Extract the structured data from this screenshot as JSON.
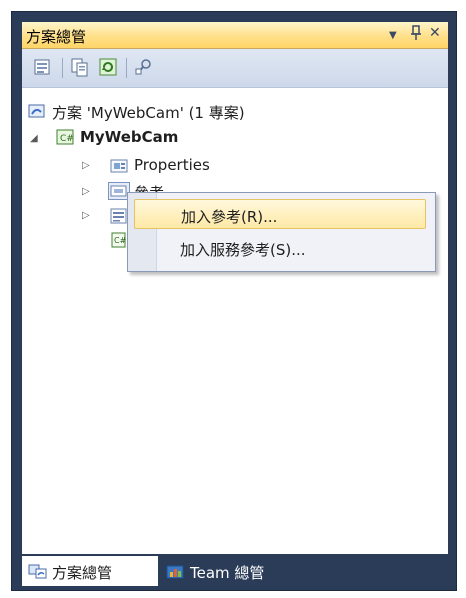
{
  "panel": {
    "title": "方案總管",
    "dropdown_glyph": "▼",
    "pin_glyph": "ᛉ",
    "close_glyph": "✕"
  },
  "toolbar": {
    "buttons": [
      "properties-icon",
      "show-all-files-icon",
      "refresh-icon",
      "class-diagram-icon"
    ]
  },
  "tree": {
    "solution": {
      "label": "方案 'MyWebCam' (1 專案)",
      "icon": "solution-icon"
    },
    "project": {
      "label": "MyWebCam",
      "icon": "csharp-project-icon",
      "expanded_glyph": "◢"
    },
    "items": [
      {
        "label": "Properties",
        "icon": "properties-folder-icon",
        "collapsed_glyph": "▷"
      },
      {
        "label": "參考",
        "icon": "references-icon",
        "collapsed_glyph": "▷"
      },
      {
        "label": "",
        "icon": "form-icon",
        "collapsed_glyph": "▷"
      },
      {
        "label": "",
        "icon": "csharp-file-icon",
        "collapsed_glyph": ""
      }
    ]
  },
  "context_menu": {
    "items": [
      {
        "label": "加入參考(R)...",
        "highlighted": true
      },
      {
        "label": "加入服務參考(S)...",
        "highlighted": false
      }
    ]
  },
  "tabs": [
    {
      "label": "方案總管",
      "icon": "solution-explorer-icon",
      "active": true
    },
    {
      "label": "Team 總管",
      "icon": "team-explorer-icon",
      "active": false
    }
  ]
}
